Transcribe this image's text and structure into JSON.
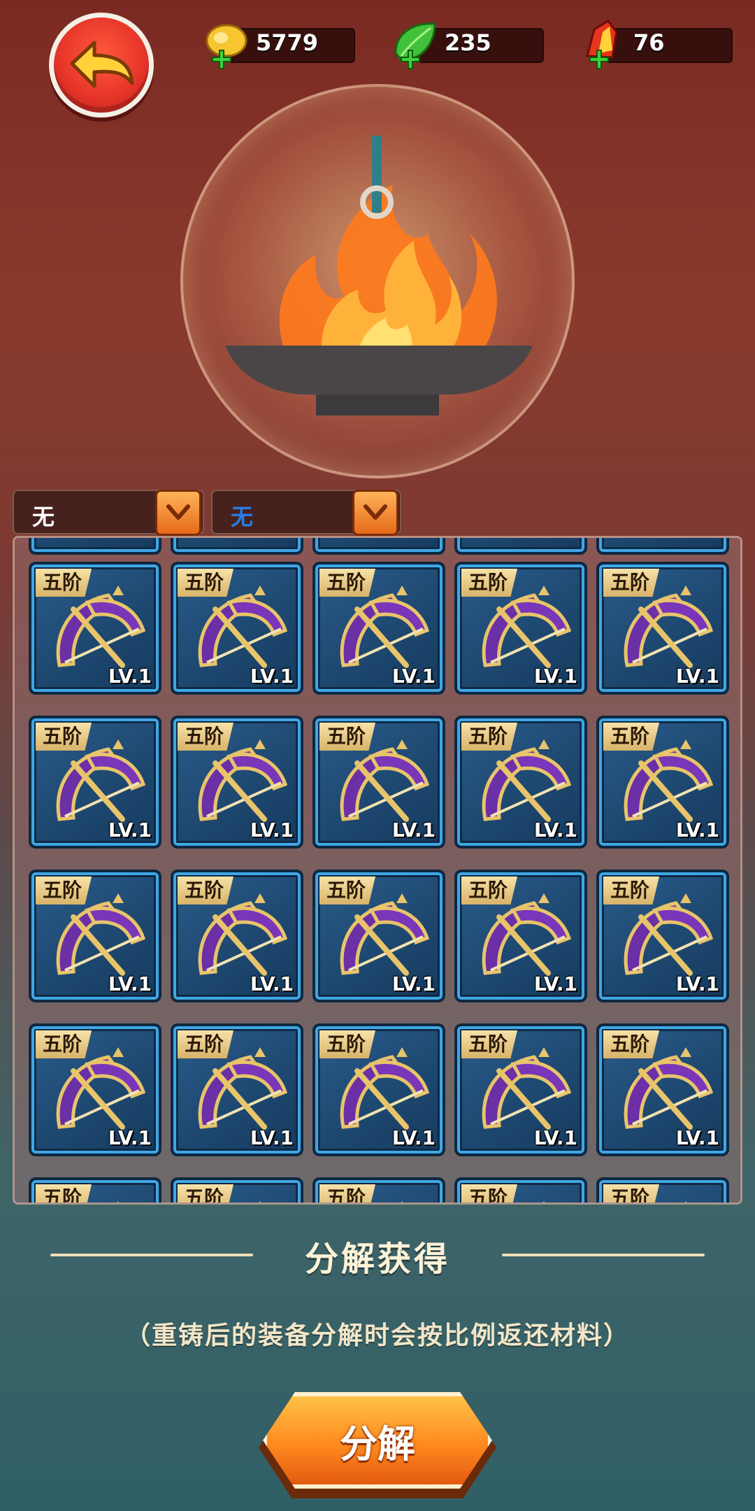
{
  "currencies": [
    {
      "name": "gold",
      "value": "5779",
      "icon": "gold-coin-icon",
      "color": "#f2c230"
    },
    {
      "name": "leaf",
      "value": "235",
      "icon": "green-leaf-icon",
      "color": "#3fbf3a"
    },
    {
      "name": "gem",
      "value": "76",
      "icon": "red-crystal-icon",
      "color": "#e23a1e"
    }
  ],
  "filters": [
    {
      "label": "无",
      "color": "#ffffff"
    },
    {
      "label": "无",
      "color": "#2a7be4"
    }
  ],
  "item_card": {
    "tier": "五阶",
    "level": "LV.1",
    "icon": "purple-bow-icon"
  },
  "grid": {
    "columns": 5,
    "visible_rows": 5
  },
  "section_title": "分解获得",
  "hint": "（重铸后的装备分解时会按比例返还材料）",
  "action_button": "分解"
}
